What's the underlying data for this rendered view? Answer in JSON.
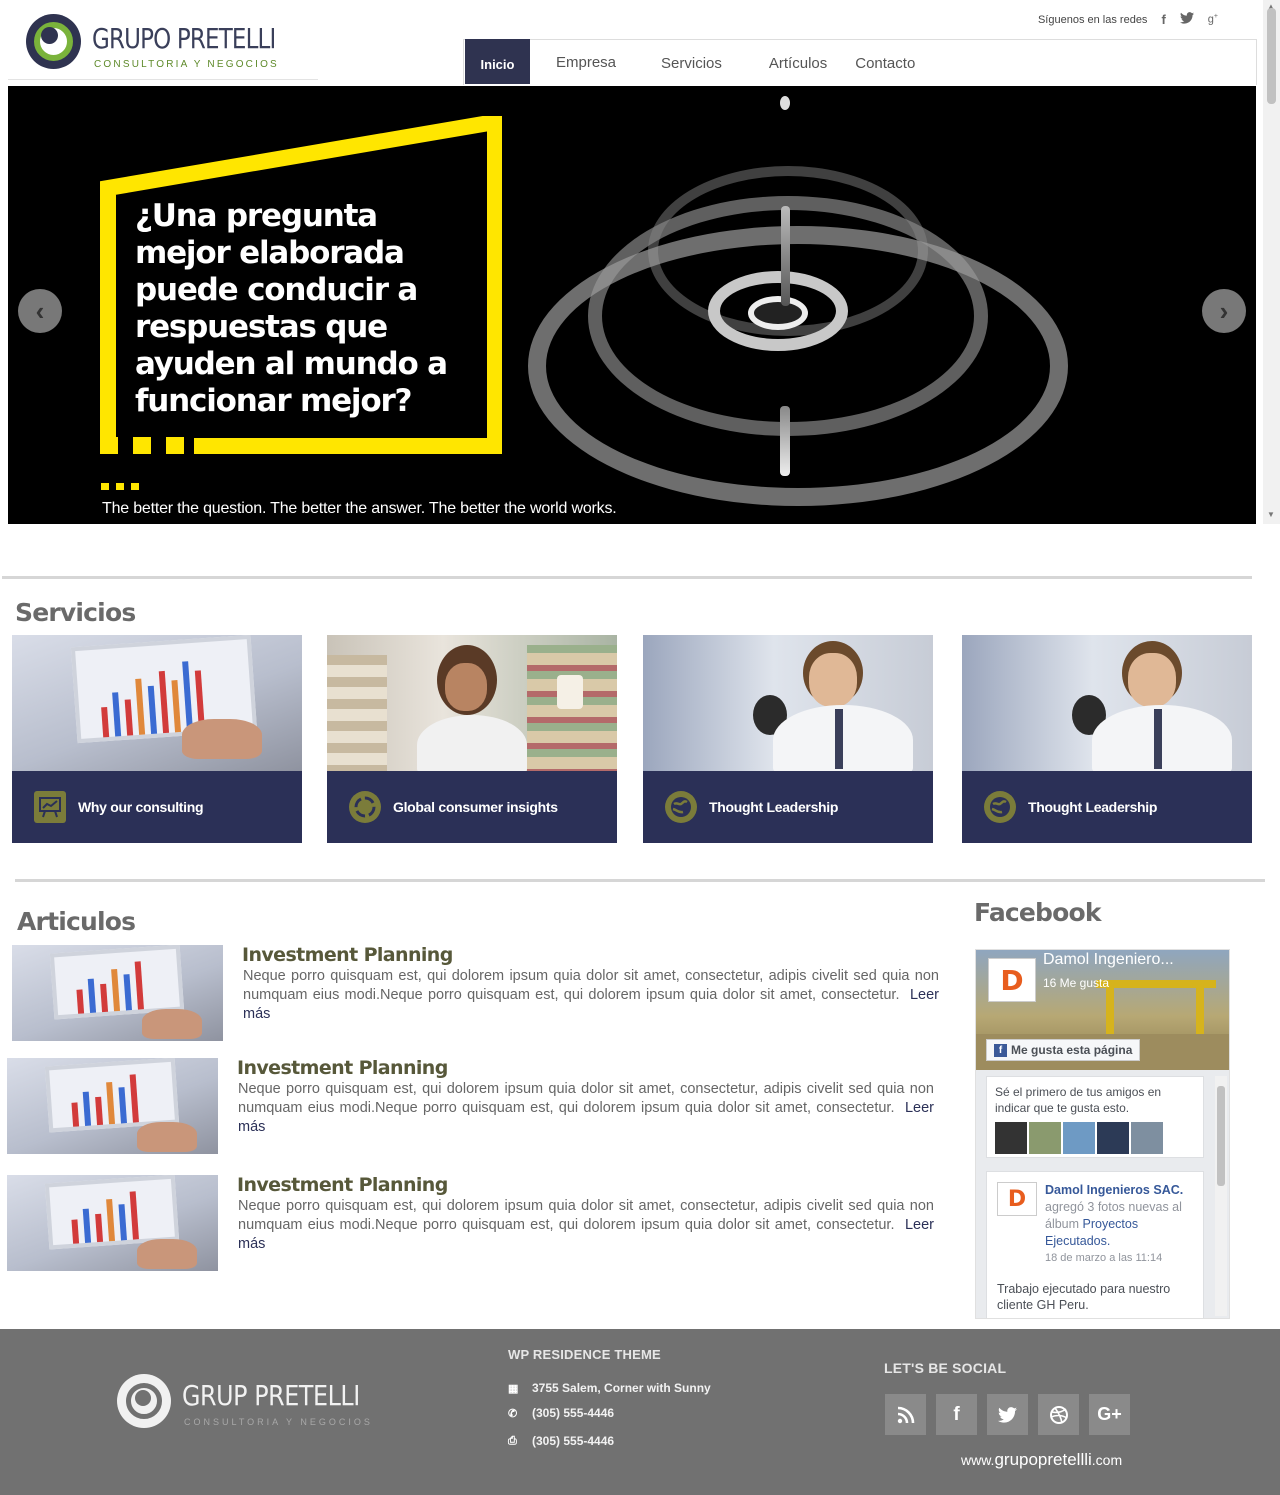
{
  "header": {
    "logo_title": "GRUPO PRETELLI",
    "logo_subtitle": "CONSULTORIA Y NEGOCIOS",
    "social_label": "Síguenos en las redes",
    "social_icons": [
      "facebook-icon",
      "twitter-icon",
      "google-plus-icon"
    ]
  },
  "nav": {
    "items": [
      {
        "label": "Inicio",
        "active": true
      },
      {
        "label": "Empresa",
        "active": false
      },
      {
        "label": "Servicios",
        "active": false
      },
      {
        "label": "Artículos",
        "active": false
      },
      {
        "label": "Contacto",
        "active": false
      }
    ]
  },
  "hero": {
    "question": "¿Una pregunta mejor elaborada puede conducir a respuestas que ayuden al mundo a funcionar mejor?",
    "tagline": "The better the question. The better the answer. The better the world works.",
    "accent_color": "#ffe600",
    "prev_arrow": "‹",
    "next_arrow": "›"
  },
  "servicios": {
    "title": "Servicios",
    "cards": [
      {
        "label": "Why our consulting",
        "icon": "chart-board-icon"
      },
      {
        "label": "Global consumer insights",
        "icon": "cycle-icon"
      },
      {
        "label": "Thought Leadership",
        "icon": "globe-icon"
      },
      {
        "label": "Thought Leadership",
        "icon": "globe-icon"
      }
    ]
  },
  "articulos": {
    "title": "Articulos",
    "items": [
      {
        "title": "Investment Planning",
        "text": "Neque porro quisquam est, qui dolorem ipsum quia dolor sit amet, consectetur, adipis civelit sed quia non numquam eius modi.Neque porro quisquam est, qui dolorem ipsum quia dolor sit amet, consectetur.",
        "more": "Leer más"
      },
      {
        "title": "Investment Planning",
        "text": "Neque porro quisquam est, qui dolorem ipsum quia dolor sit amet, consectetur, adipis civelit sed quia non numquam eius modi.Neque porro quisquam est, qui dolorem ipsum quia dolor sit amet, consectetur.",
        "more": "Leer más"
      },
      {
        "title": "Investment Planning",
        "text": "Neque porro quisquam est, qui dolorem ipsum quia dolor sit amet, consectetur, adipis civelit sed quia non numquam eius modi.Neque porro quisquam est, qui dolorem ipsum quia dolor sit amet, consectetur.",
        "more": "Leer más"
      }
    ]
  },
  "facebook": {
    "title": "Facebook",
    "page_name": "Damol Ingeniero...",
    "likes": "16 Me gusta",
    "like_button": "Me gusta esta página",
    "friends_text": "Sé el primero de tus amigos en indicar que te gusta esto.",
    "post_author": "Damol Ingenieros SAC.",
    "post_action": "agregó 3 fotos nuevas al álbum",
    "post_album": "Proyectos Ejecutados.",
    "post_date": "18 de marzo a las 11:14",
    "post_text": "Trabajo ejecutado para nuestro cliente GH Peru."
  },
  "footer": {
    "logo_title": "GRUP PRETELLI",
    "logo_subtitle": "CONSULTORIA Y NEGOCIOS",
    "contact_title": "WP RESIDENCE THEME",
    "address": "3755 Salem, Corner with Sunny",
    "phone": "(305) 555-4446",
    "fax": "(305) 555-4446",
    "social_title": "LET'S BE SOCIAL",
    "social_icons": [
      "rss-icon",
      "facebook-icon",
      "twitter-icon",
      "dribbble-icon",
      "google-plus-icon"
    ],
    "website_prefix": "www.",
    "website_name": "grupopretellli",
    "website_suffix": ".com"
  }
}
